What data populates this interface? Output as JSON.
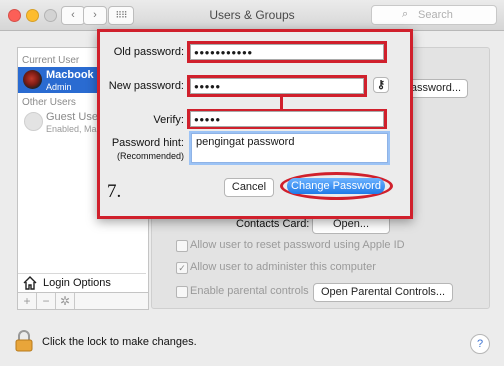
{
  "window": {
    "title": "Users & Groups",
    "search_placeholder": "Search"
  },
  "sidebar": {
    "current_user_header": "Current User",
    "current_user": {
      "name": "Macbook P",
      "role": "Admin"
    },
    "other_users_header": "Other Users",
    "guest_user": {
      "name": "Guest User",
      "status": "Enabled, Ma"
    },
    "login_options": "Login Options",
    "add": "+",
    "remove": "−",
    "gear": "✲"
  },
  "pane": {
    "change_password_button": "assword...",
    "contacts_card_label": "Contacts Card:",
    "open_button": "Open...",
    "allow_reset": "Allow user to reset password using Apple ID",
    "allow_admin": "Allow user to administer this computer",
    "parental_controls": "Enable parental controls",
    "open_parental_button": "Open Parental Controls..."
  },
  "dialog": {
    "old_password_label": "Old password:",
    "old_password_value": "●●●●●●●●●●●",
    "new_password_label": "New password:",
    "new_password_value": "●●●●●",
    "verify_label": "Verify:",
    "verify_value": "●●●●●",
    "hint_label": "Password hint:",
    "hint_sublabel": "(Recommended)",
    "hint_value": "pengingat password",
    "step_annotation": "7.",
    "cancel_button": "Cancel",
    "change_password_button": "Change Password",
    "key_icon": "⚷"
  },
  "bottom": {
    "lock_text": "Click the lock to make changes.",
    "help": "?"
  },
  "colors": {
    "annotation_red": "#d0202c",
    "selection_blue": "#2a6bd1",
    "button_blue": "#1f7ae8"
  }
}
